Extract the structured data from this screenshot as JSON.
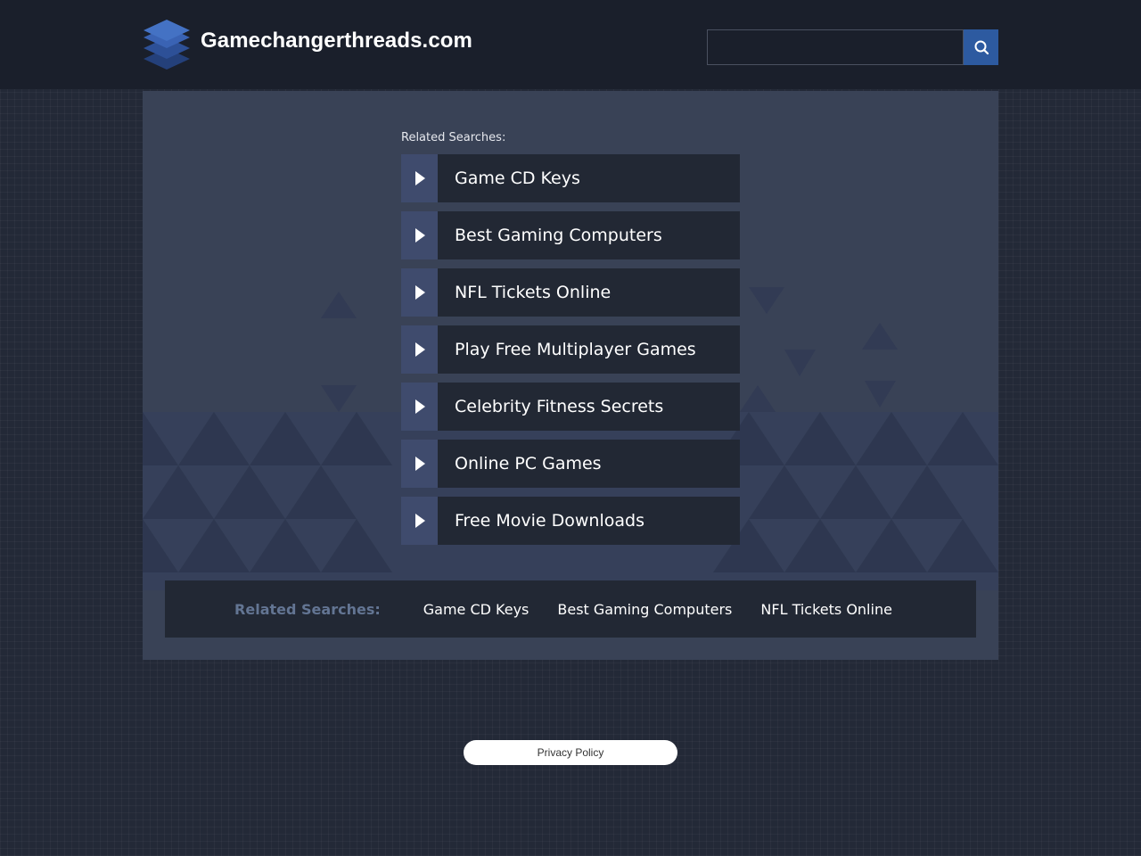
{
  "header": {
    "site_name": "Gamechangerthreads.com",
    "logo_icon": "stacked-layers-logo",
    "search": {
      "value": "",
      "placeholder": "",
      "button_icon": "search-icon"
    }
  },
  "main": {
    "heading": "Related Searches:",
    "links": [
      {
        "label": "Game CD Keys"
      },
      {
        "label": "Best Gaming Computers"
      },
      {
        "label": "NFL Tickets Online"
      },
      {
        "label": "Play Free Multiplayer Games"
      },
      {
        "label": "Celebrity Fitness Secrets"
      },
      {
        "label": "Online PC Games"
      },
      {
        "label": "Free Movie Downloads"
      }
    ],
    "arrow_icon": "play-arrow-icon"
  },
  "footer_bar": {
    "title": "Related Searches:",
    "links": [
      {
        "label": "Game CD Keys"
      },
      {
        "label": "Best Gaming Computers"
      },
      {
        "label": "NFL Tickets Online"
      }
    ]
  },
  "footer": {
    "privacy_label": "Privacy Policy"
  },
  "colors": {
    "accent": "#2d5aa0",
    "header_bg": "#1a1f2b",
    "panel_bg": "#394256",
    "link_bg": "#222834",
    "arrow_bg": "#3f4b6d",
    "muted_title": "#637593"
  }
}
